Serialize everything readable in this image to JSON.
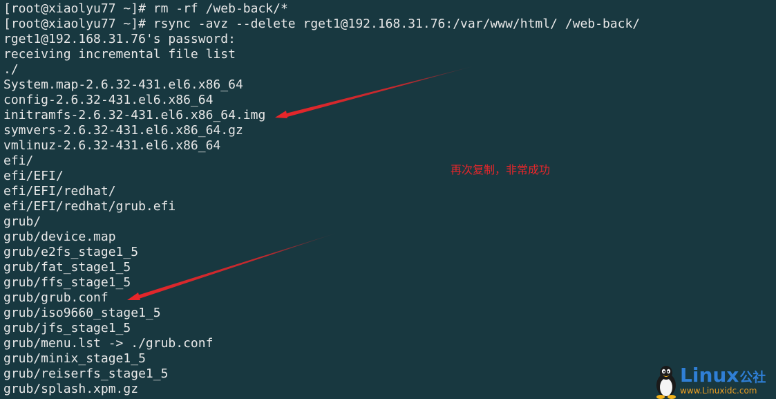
{
  "terminal": {
    "lines": [
      "[root@xiaolyu77 ~]# rm -rf /web-back/*",
      "[root@xiaolyu77 ~]# rsync -avz --delete rget1@192.168.31.76:/var/www/html/ /web-back/",
      "rget1@192.168.31.76's password:",
      "receiving incremental file list",
      "./",
      "System.map-2.6.32-431.el6.x86_64",
      "config-2.6.32-431.el6.x86_64",
      "initramfs-2.6.32-431.el6.x86_64.img",
      "symvers-2.6.32-431.el6.x86_64.gz",
      "vmlinuz-2.6.32-431.el6.x86_64",
      "efi/",
      "efi/EFI/",
      "efi/EFI/redhat/",
      "efi/EFI/redhat/grub.efi",
      "grub/",
      "grub/device.map",
      "grub/e2fs_stage1_5",
      "grub/fat_stage1_5",
      "grub/ffs_stage1_5",
      "grub/grub.conf",
      "grub/iso9660_stage1_5",
      "grub/jfs_stage1_5",
      "grub/menu.lst -> ./grub.conf",
      "grub/minix_stage1_5",
      "grub/reiserfs_stage1_5",
      "grub/splash.xpm.gz"
    ]
  },
  "annotation": {
    "text": "再次复制，非常成功",
    "color": "#e8262a"
  },
  "watermark": {
    "brand": "Linux",
    "brand_cn": "公社",
    "url": "www.Linuxidc.com",
    "icon": "tux-penguin-icon"
  },
  "colors": {
    "background": "#183840",
    "text": "#e8e8e8",
    "arrow": "#e8262a"
  }
}
